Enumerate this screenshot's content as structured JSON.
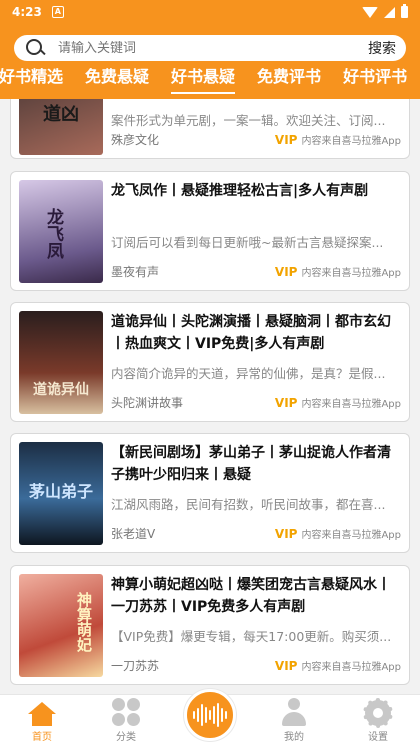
{
  "status_bar": {
    "time": "4:23",
    "notif_letter": "A"
  },
  "search": {
    "placeholder": "请输入关键词",
    "button_label": "搜索"
  },
  "tabs": [
    {
      "label": "好书精选",
      "active": false
    },
    {
      "label": "免费悬疑",
      "active": false
    },
    {
      "label": "好书悬疑",
      "active": true
    },
    {
      "label": "免费评书",
      "active": false
    },
    {
      "label": "好书评书",
      "active": false
    }
  ],
  "books": [
    {
      "cover_text": "道凶",
      "title": "",
      "desc": "案件形式为单元剧，一案一辑。欢迎关注、订阅...",
      "author": "殊彦文化",
      "vip": "VIP",
      "source": "内容来自喜马拉雅App",
      "cover_colors": [
        "#3a3030",
        "#a86a5a"
      ]
    },
    {
      "cover_text": "龙飞凤",
      "title": "龙飞凤作丨悬疑推理轻松古言|多人有声剧",
      "desc": "订阅后可以看到每日更新哦~最新古言悬疑探案...",
      "author": "墨夜有声",
      "vip": "VIP",
      "source": "内容来自喜马拉雅App",
      "cover_colors": [
        "#6b5a8c",
        "#d6c8e6"
      ]
    },
    {
      "cover_text": "道诡异仙",
      "title": "道诡异仙丨头陀渊演播丨悬疑脑洞丨都市玄幻丨热血爽文丨VIP免费|多人有声剧",
      "desc": "内容简介诡异的天道，异常的仙佛，是真？是假...",
      "author": "头陀渊讲故事",
      "vip": "VIP",
      "source": "内容来自喜马拉雅App",
      "cover_colors": [
        "#2a1e1e",
        "#7a3a2a"
      ]
    },
    {
      "cover_text": "茅山弟子",
      "title": "【新民间剧场】茅山弟子丨茅山捉诡人作者清子携叶少阳归来丨悬疑",
      "desc": "江湖风雨路，民间有招数，听民间故事，都在喜...",
      "author": "张老道V",
      "vip": "VIP",
      "source": "内容来自喜马拉雅App",
      "cover_colors": [
        "#1c2e44",
        "#3b6b9a"
      ]
    },
    {
      "cover_text": "神算萌妃",
      "title": "神算小萌妃超凶哒丨爆笑团宠古言悬疑风水丨一刀苏苏丨VIP免费多人有声剧",
      "desc": "【VIP免费】爆更专辑，每天17:00更新。购买须...",
      "author": "一刀苏苏",
      "vip": "VIP",
      "source": "内容来自喜马拉雅App",
      "cover_colors": [
        "#c04a3a",
        "#f0b0a0"
      ]
    }
  ],
  "bottom_nav": [
    {
      "label": "首页",
      "icon": "home-icon",
      "active": true
    },
    {
      "label": "分类",
      "icon": "category-icon",
      "active": false
    },
    {
      "label": "",
      "icon": "play-wave-icon",
      "active": false
    },
    {
      "label": "我的",
      "icon": "user-icon",
      "active": false
    },
    {
      "label": "设置",
      "icon": "gear-icon",
      "active": false
    }
  ],
  "colors": {
    "accent": "#f7931e",
    "vip": "#f2a300"
  }
}
